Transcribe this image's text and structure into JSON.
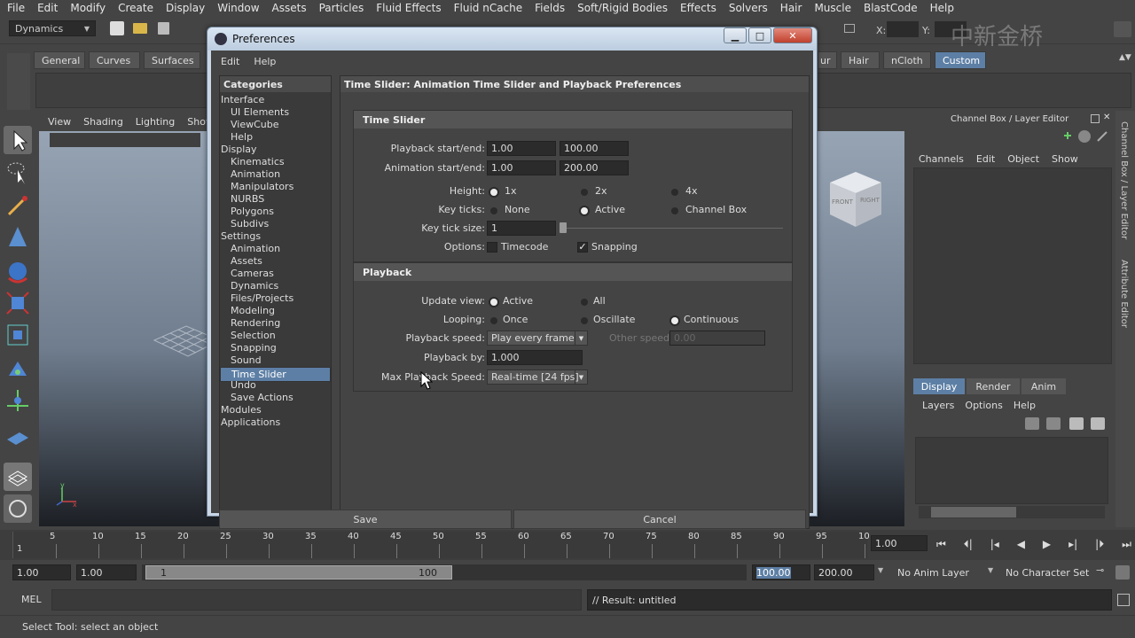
{
  "menubar": [
    "File",
    "Edit",
    "Modify",
    "Create",
    "Display",
    "Window",
    "Assets",
    "Particles",
    "Fluid Effects",
    "Fluid nCache",
    "Fields",
    "Soft/Rigid Bodies",
    "Effects",
    "Solvers",
    "Hair",
    "Muscle",
    "BlastCode",
    "Help"
  ],
  "status": {
    "menuset": "Dynamics",
    "x_label": "X:",
    "y_label": "Y:"
  },
  "shelf_tabs": {
    "left": [
      "General",
      "Curves",
      "Surfaces"
    ],
    "right": [
      "ur",
      "Hair",
      "nCloth",
      "Custom"
    ]
  },
  "panel_menu": [
    "View",
    "Shading",
    "Lighting",
    "Show"
  ],
  "viewcube": {
    "front": "FRONT",
    "right": "RIGHT"
  },
  "channel_box": {
    "title": "Channel Box / Layer Editor",
    "menu": [
      "Channels",
      "Edit",
      "Object",
      "Show"
    ]
  },
  "layer_editor": {
    "tabs": [
      "Display",
      "Render",
      "Anim"
    ],
    "menu": [
      "Layers",
      "Options",
      "Help"
    ]
  },
  "vertical_tabs": [
    "Channel Box / Layer Editor",
    "Attribute Editor"
  ],
  "timeline": {
    "ticks": [
      "5",
      "10",
      "15",
      "20",
      "25",
      "30",
      "35",
      "40",
      "45",
      "50",
      "55",
      "60",
      "65",
      "70",
      "75",
      "80",
      "85",
      "90",
      "95",
      "10"
    ],
    "start_marker": "1",
    "current": "1.00"
  },
  "range": {
    "start": "1.00",
    "start2": "1.00",
    "slider_start": "1",
    "slider_end": "100",
    "end": "100.00",
    "end2": "200.00",
    "anim_layer": "No Anim Layer",
    "char_set": "No Character Set"
  },
  "mel": {
    "label": "MEL",
    "result": "// Result: untitled"
  },
  "help_line": "Select Tool: select an object",
  "watermark": "中新金桥",
  "dialog": {
    "title": "Preferences",
    "menu": [
      "Edit",
      "Help"
    ],
    "categories_header": "Categories",
    "categories": [
      {
        "label": "Interface",
        "indent": 0
      },
      {
        "label": "UI Elements",
        "indent": 1
      },
      {
        "label": "ViewCube",
        "indent": 1
      },
      {
        "label": "Help",
        "indent": 1
      },
      {
        "label": "Display",
        "indent": 0
      },
      {
        "label": "Kinematics",
        "indent": 1
      },
      {
        "label": "Animation",
        "indent": 1
      },
      {
        "label": "Manipulators",
        "indent": 1
      },
      {
        "label": "NURBS",
        "indent": 1
      },
      {
        "label": "Polygons",
        "indent": 1
      },
      {
        "label": "Subdivs",
        "indent": 1
      },
      {
        "label": "Settings",
        "indent": 0
      },
      {
        "label": "Animation",
        "indent": 1
      },
      {
        "label": "Assets",
        "indent": 1
      },
      {
        "label": "Cameras",
        "indent": 1
      },
      {
        "label": "Dynamics",
        "indent": 1
      },
      {
        "label": "Files/Projects",
        "indent": 1
      },
      {
        "label": "Modeling",
        "indent": 1
      },
      {
        "label": "Rendering",
        "indent": 1
      },
      {
        "label": "Selection",
        "indent": 1
      },
      {
        "label": "Snapping",
        "indent": 1
      },
      {
        "label": "Sound",
        "indent": 1
      },
      {
        "label": "Time Slider",
        "indent": 1,
        "selected": true
      },
      {
        "label": "Undo",
        "indent": 1
      },
      {
        "label": "Save Actions",
        "indent": 1
      },
      {
        "label": "Modules",
        "indent": 0
      },
      {
        "label": "Applications",
        "indent": 0
      }
    ],
    "settings_header": "Time Slider: Animation Time Slider and Playback Preferences",
    "time_slider": {
      "header": "Time Slider",
      "playback_label": "Playback start/end:",
      "playback_start": "1.00",
      "playback_end": "100.00",
      "anim_label": "Animation start/end:",
      "anim_start": "1.00",
      "anim_end": "200.00",
      "height_label": "Height:",
      "height_options": [
        "1x",
        "2x",
        "4x"
      ],
      "height_selected": 0,
      "keyticks_label": "Key ticks:",
      "keyticks_options": [
        "None",
        "Active",
        "Channel Box"
      ],
      "keyticks_selected": 1,
      "keytick_size_label": "Key tick size:",
      "keytick_size": "1",
      "options_label": "Options:",
      "timecode": "Timecode",
      "timecode_checked": false,
      "snapping": "Snapping",
      "snapping_checked": true
    },
    "playback": {
      "header": "Playback",
      "update_label": "Update view:",
      "update_options": [
        "Active",
        "All"
      ],
      "update_selected": 0,
      "looping_label": "Looping:",
      "looping_options": [
        "Once",
        "Oscillate",
        "Continuous"
      ],
      "looping_selected": 2,
      "speed_label": "Playback speed:",
      "speed_value": "Play every frame",
      "other_speed_label": "Other speed:",
      "other_speed": "0.00",
      "by_label": "Playback by:",
      "by_value": "1.000",
      "max_label": "Max Playback Speed:",
      "max_value": "Real-time [24 fps]"
    },
    "save": "Save",
    "cancel": "Cancel"
  }
}
